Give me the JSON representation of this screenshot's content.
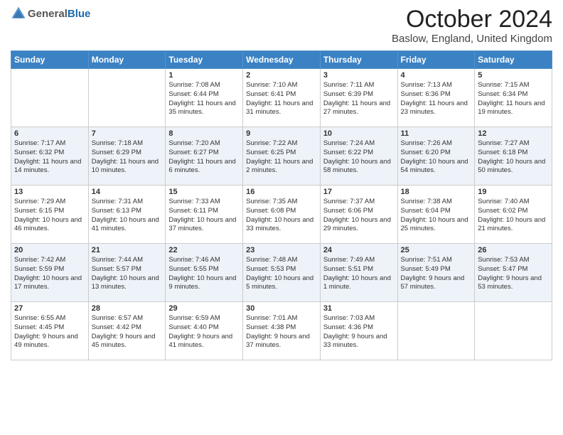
{
  "header": {
    "logo_general": "General",
    "logo_blue": "Blue",
    "title": "October 2024",
    "location": "Baslow, England, United Kingdom"
  },
  "days_of_week": [
    "Sunday",
    "Monday",
    "Tuesday",
    "Wednesday",
    "Thursday",
    "Friday",
    "Saturday"
  ],
  "weeks": [
    [
      {
        "day": "",
        "info": ""
      },
      {
        "day": "",
        "info": ""
      },
      {
        "day": "1",
        "info": "Sunrise: 7:08 AM\nSunset: 6:44 PM\nDaylight: 11 hours and 35 minutes."
      },
      {
        "day": "2",
        "info": "Sunrise: 7:10 AM\nSunset: 6:41 PM\nDaylight: 11 hours and 31 minutes."
      },
      {
        "day": "3",
        "info": "Sunrise: 7:11 AM\nSunset: 6:39 PM\nDaylight: 11 hours and 27 minutes."
      },
      {
        "day": "4",
        "info": "Sunrise: 7:13 AM\nSunset: 6:36 PM\nDaylight: 11 hours and 23 minutes."
      },
      {
        "day": "5",
        "info": "Sunrise: 7:15 AM\nSunset: 6:34 PM\nDaylight: 11 hours and 19 minutes."
      }
    ],
    [
      {
        "day": "6",
        "info": "Sunrise: 7:17 AM\nSunset: 6:32 PM\nDaylight: 11 hours and 14 minutes."
      },
      {
        "day": "7",
        "info": "Sunrise: 7:18 AM\nSunset: 6:29 PM\nDaylight: 11 hours and 10 minutes."
      },
      {
        "day": "8",
        "info": "Sunrise: 7:20 AM\nSunset: 6:27 PM\nDaylight: 11 hours and 6 minutes."
      },
      {
        "day": "9",
        "info": "Sunrise: 7:22 AM\nSunset: 6:25 PM\nDaylight: 11 hours and 2 minutes."
      },
      {
        "day": "10",
        "info": "Sunrise: 7:24 AM\nSunset: 6:22 PM\nDaylight: 10 hours and 58 minutes."
      },
      {
        "day": "11",
        "info": "Sunrise: 7:26 AM\nSunset: 6:20 PM\nDaylight: 10 hours and 54 minutes."
      },
      {
        "day": "12",
        "info": "Sunrise: 7:27 AM\nSunset: 6:18 PM\nDaylight: 10 hours and 50 minutes."
      }
    ],
    [
      {
        "day": "13",
        "info": "Sunrise: 7:29 AM\nSunset: 6:15 PM\nDaylight: 10 hours and 46 minutes."
      },
      {
        "day": "14",
        "info": "Sunrise: 7:31 AM\nSunset: 6:13 PM\nDaylight: 10 hours and 41 minutes."
      },
      {
        "day": "15",
        "info": "Sunrise: 7:33 AM\nSunset: 6:11 PM\nDaylight: 10 hours and 37 minutes."
      },
      {
        "day": "16",
        "info": "Sunrise: 7:35 AM\nSunset: 6:08 PM\nDaylight: 10 hours and 33 minutes."
      },
      {
        "day": "17",
        "info": "Sunrise: 7:37 AM\nSunset: 6:06 PM\nDaylight: 10 hours and 29 minutes."
      },
      {
        "day": "18",
        "info": "Sunrise: 7:38 AM\nSunset: 6:04 PM\nDaylight: 10 hours and 25 minutes."
      },
      {
        "day": "19",
        "info": "Sunrise: 7:40 AM\nSunset: 6:02 PM\nDaylight: 10 hours and 21 minutes."
      }
    ],
    [
      {
        "day": "20",
        "info": "Sunrise: 7:42 AM\nSunset: 5:59 PM\nDaylight: 10 hours and 17 minutes."
      },
      {
        "day": "21",
        "info": "Sunrise: 7:44 AM\nSunset: 5:57 PM\nDaylight: 10 hours and 13 minutes."
      },
      {
        "day": "22",
        "info": "Sunrise: 7:46 AM\nSunset: 5:55 PM\nDaylight: 10 hours and 9 minutes."
      },
      {
        "day": "23",
        "info": "Sunrise: 7:48 AM\nSunset: 5:53 PM\nDaylight: 10 hours and 5 minutes."
      },
      {
        "day": "24",
        "info": "Sunrise: 7:49 AM\nSunset: 5:51 PM\nDaylight: 10 hours and 1 minute."
      },
      {
        "day": "25",
        "info": "Sunrise: 7:51 AM\nSunset: 5:49 PM\nDaylight: 9 hours and 57 minutes."
      },
      {
        "day": "26",
        "info": "Sunrise: 7:53 AM\nSunset: 5:47 PM\nDaylight: 9 hours and 53 minutes."
      }
    ],
    [
      {
        "day": "27",
        "info": "Sunrise: 6:55 AM\nSunset: 4:45 PM\nDaylight: 9 hours and 49 minutes."
      },
      {
        "day": "28",
        "info": "Sunrise: 6:57 AM\nSunset: 4:42 PM\nDaylight: 9 hours and 45 minutes."
      },
      {
        "day": "29",
        "info": "Sunrise: 6:59 AM\nSunset: 4:40 PM\nDaylight: 9 hours and 41 minutes."
      },
      {
        "day": "30",
        "info": "Sunrise: 7:01 AM\nSunset: 4:38 PM\nDaylight: 9 hours and 37 minutes."
      },
      {
        "day": "31",
        "info": "Sunrise: 7:03 AM\nSunset: 4:36 PM\nDaylight: 9 hours and 33 minutes."
      },
      {
        "day": "",
        "info": ""
      },
      {
        "day": "",
        "info": ""
      }
    ]
  ]
}
